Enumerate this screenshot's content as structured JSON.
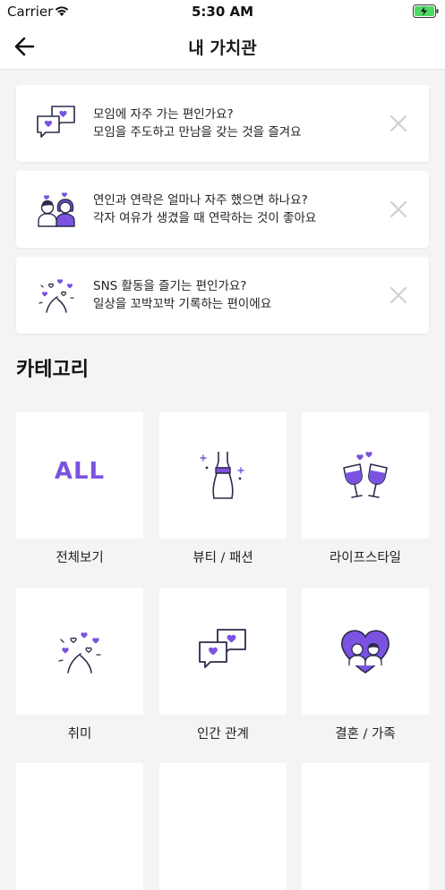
{
  "status_bar": {
    "carrier": "Carrier",
    "time": "5:30 AM"
  },
  "nav": {
    "title": "내 가치관",
    "back_icon": "arrow-left-icon"
  },
  "question_cards": [
    {
      "question": "모임에 자주 가는 편인가요?",
      "answer": "모임을 주도하고 만남을 갖는 것을 즐겨요",
      "icon": "speech-bubbles-heart-icon"
    },
    {
      "question": "연인과 연락은 얼마나 자주 했으면 하나요?",
      "answer": "각자 여유가 생겼을 때 연락하는 것이 좋아요",
      "icon": "couple-icon"
    },
    {
      "question": "SNS 활동을 즐기는 편인가요?",
      "answer": "일상을 꼬박꼬박 기록하는 편이에요",
      "icon": "hearts-burst-icon"
    }
  ],
  "categories_section": {
    "title": "카테고리",
    "items": [
      {
        "label": "전체보기",
        "icon_text": "ALL"
      },
      {
        "label": "뷰티 / 패션",
        "icon": "dress-icon"
      },
      {
        "label": "라이프스타일",
        "icon": "wine-toast-icon"
      },
      {
        "label": "취미",
        "icon": "hearts-burst-icon"
      },
      {
        "label": "인간 관계",
        "icon": "speech-bubbles-heart-icon"
      },
      {
        "label": "결혼 / 가족",
        "icon": "couple-heart-icon"
      }
    ]
  },
  "colors": {
    "accent": "#7b53e0",
    "outline": "#2d2a4a",
    "background": "#f4f4f6",
    "card": "#ffffff"
  }
}
